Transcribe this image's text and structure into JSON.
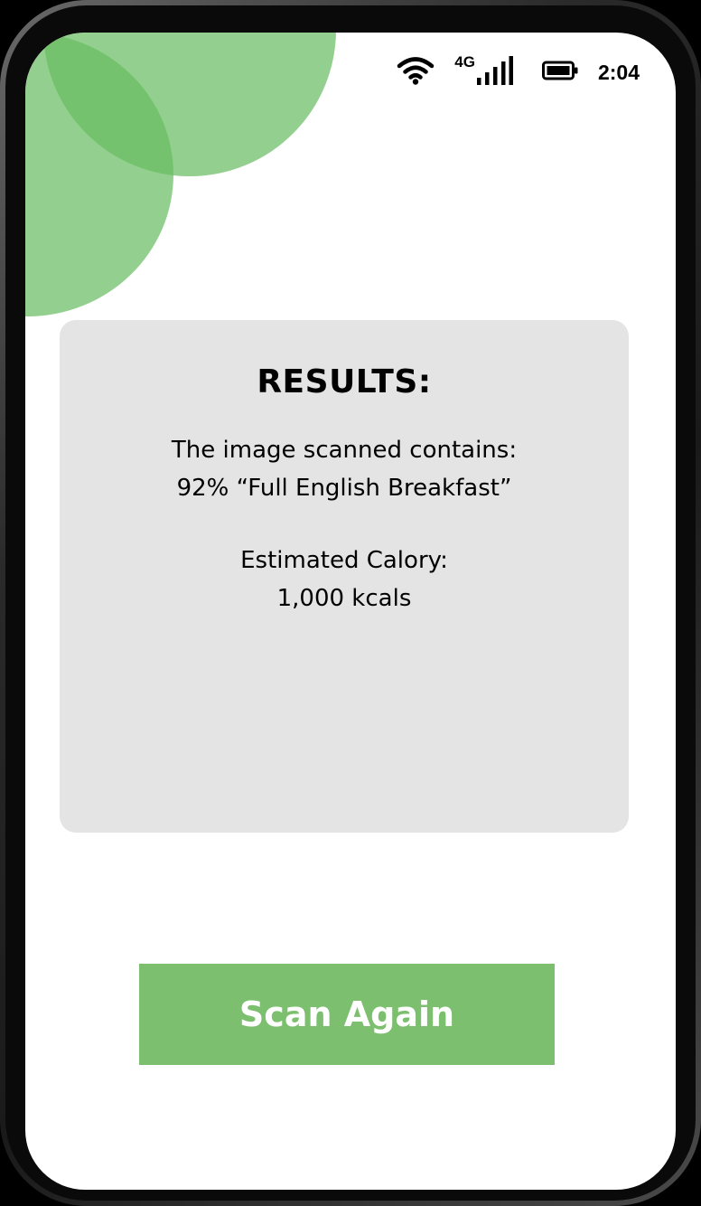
{
  "status_bar": {
    "network_type": "4G",
    "time": "2:04",
    "icons": [
      "wifi-icon",
      "cellular-signal-icon",
      "battery-icon"
    ]
  },
  "results": {
    "title": "RESULTS:",
    "contains_label": "The image scanned contains:",
    "detection": "92% “Full English Breakfast”",
    "calorie_label": "Estimated Calory:",
    "calorie_value": "1,000 kcals"
  },
  "actions": {
    "scan_again_label": "Scan Again"
  },
  "colors": {
    "accent_green": "#7bbf6f",
    "blob_green": "#6abc62",
    "card_background": "#e4e4e4",
    "screen_background": "#ffffff"
  }
}
